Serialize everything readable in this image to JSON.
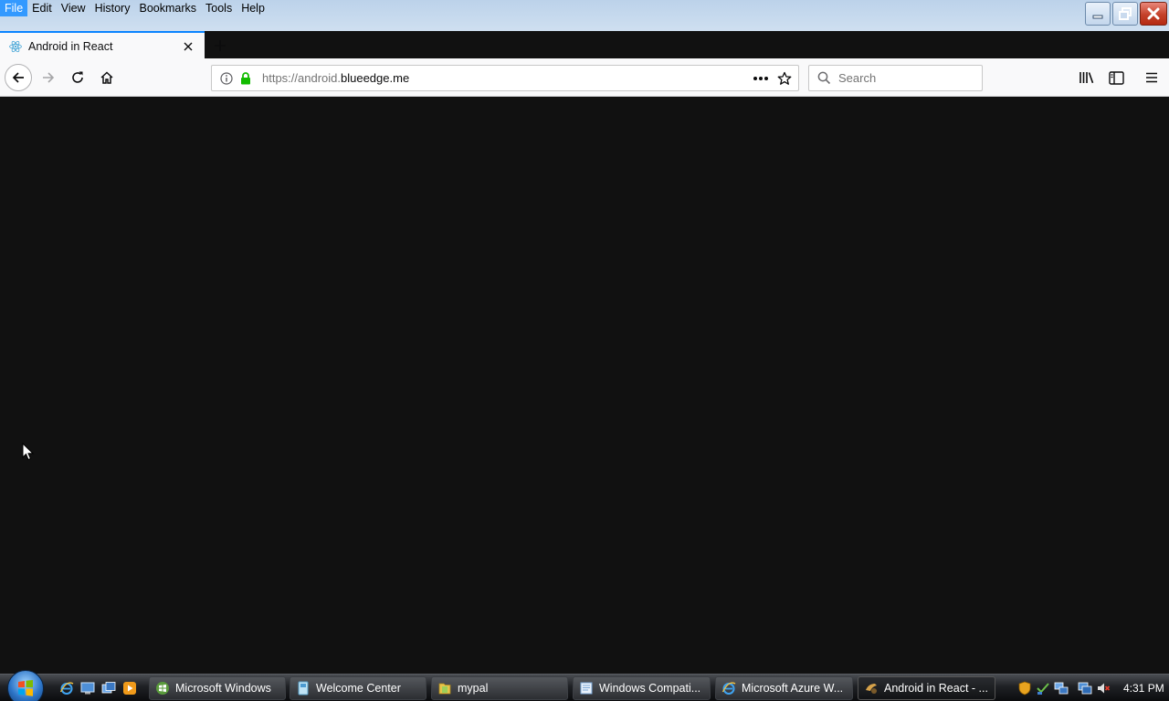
{
  "menu": {
    "items": [
      {
        "label": "File",
        "key": "F"
      },
      {
        "label": "Edit",
        "key": "E"
      },
      {
        "label": "View",
        "key": "V"
      },
      {
        "label": "History",
        "key": "s"
      },
      {
        "label": "Bookmarks",
        "key": "B"
      },
      {
        "label": "Tools",
        "key": "T"
      },
      {
        "label": "Help",
        "key": "H"
      }
    ],
    "active": "File"
  },
  "tab": {
    "title": "Android in React",
    "favicon": "react-icon"
  },
  "urlbar": {
    "url_dim": "https://android.",
    "url_main": "blueedge.me"
  },
  "search": {
    "placeholder": "Search"
  },
  "taskbar": {
    "items": [
      {
        "label": "Microsoft Windows",
        "icon": "windows-update-icon"
      },
      {
        "label": "Welcome Center",
        "icon": "welcome-center-icon"
      },
      {
        "label": "mypal",
        "icon": "folder-icon"
      },
      {
        "label": "Windows Compati...",
        "icon": "document-icon"
      },
      {
        "label": "Microsoft Azure W...",
        "icon": "ie-icon"
      },
      {
        "label": "Android in React - ...",
        "icon": "browser-icon"
      }
    ],
    "clock": "4:31 PM"
  },
  "colors": {
    "content_bg": "#111111",
    "accent": "#0a84ff",
    "lock_green": "#12bc00",
    "menu_highlight": "#3399ff"
  }
}
